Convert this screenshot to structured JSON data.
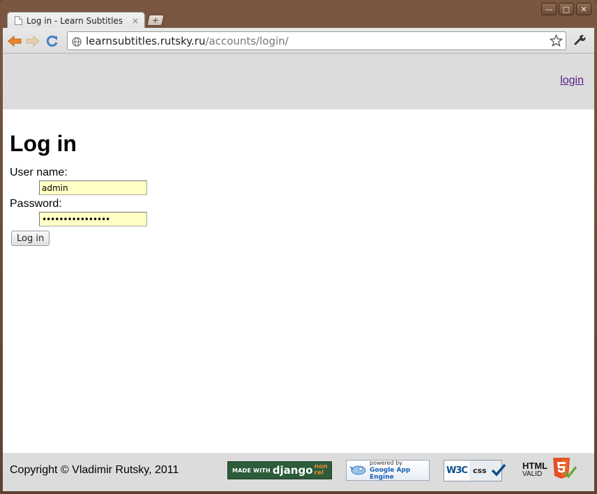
{
  "window": {
    "controls": {
      "minimize": "—",
      "maximize": "□",
      "close": "✕"
    }
  },
  "tab": {
    "title": "Log in - Learn Subtitles",
    "close": "×",
    "new_tab": "+"
  },
  "toolbar": {
    "url_host": "learnsubtitles.rutsky.ru",
    "url_path": "/accounts/login/",
    "icons": [
      "back-arrow-icon",
      "forward-arrow-icon",
      "reload-icon",
      "globe-icon",
      "bookmark-star-icon",
      "wrench-icon"
    ]
  },
  "header": {
    "login_link": "login"
  },
  "form": {
    "heading": "Log in",
    "username_label": "User name:",
    "username_value": "admin",
    "password_label": "Password:",
    "password_value": "••••••••••••••••",
    "submit_label": "Log in"
  },
  "footer": {
    "copyright": "Copyright © Vladimir Rutsky, 2011",
    "badges": {
      "django_made": "MADE WITH",
      "django_name": "django",
      "django_nonrel_1": "non",
      "django_nonrel_2": "rel",
      "gae_powered": "powered by",
      "gae_name": "Google App Engine",
      "w3c": "W3C",
      "css": "css",
      "html_title": "HTML",
      "html_valid": "VALID"
    }
  },
  "colors": {
    "accent_orange": "#e8892a",
    "link_visited": "#551a8b",
    "input_autofill_bg": "#ffffc6",
    "header_bg": "#dcdcdc"
  }
}
